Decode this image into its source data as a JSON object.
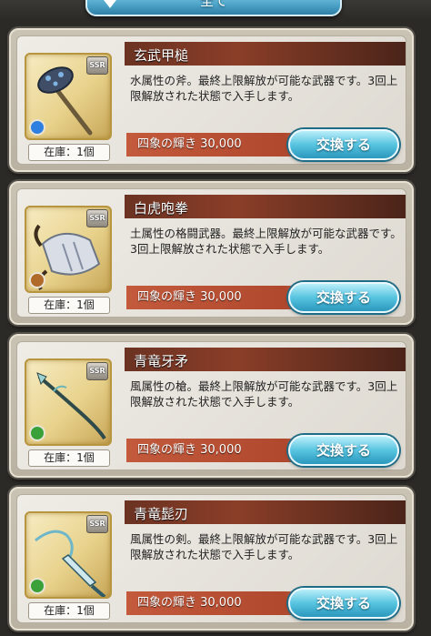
{
  "filter": {
    "label": "全て"
  },
  "items": [
    {
      "name": "玄武甲槌",
      "rarity": "SSR",
      "element": "water",
      "element_color": "#2f7fe0",
      "icon": "hammer-icon",
      "description": "水属性の斧。最終上限解放が可能な武器です。3回上限解放された状態で入手します。",
      "cost": "四象の輝き 30,000",
      "stock": "在庫：1個",
      "button": "交換する"
    },
    {
      "name": "白虎咆拳",
      "rarity": "SSR",
      "element": "earth",
      "element_color": "#b06a2a",
      "icon": "gauntlet-icon",
      "description": "土属性の格闘武器。最終上限解放が可能な武器です。3回上限解放された状態で入手します。",
      "cost": "四象の輝き 30,000",
      "stock": "在庫：1個",
      "button": "交換する"
    },
    {
      "name": "青竜牙矛",
      "rarity": "SSR",
      "element": "wind",
      "element_color": "#3aa13a",
      "icon": "spear-icon",
      "description": "風属性の槍。最終上限解放が可能な武器です。3回上限解放された状態で入手します。",
      "cost": "四象の輝き 30,000",
      "stock": "在庫：1個",
      "button": "交換する"
    },
    {
      "name": "青竜髭刃",
      "rarity": "SSR",
      "element": "wind",
      "element_color": "#3aa13a",
      "icon": "sword-icon",
      "description": "風属性の剣。最終上限解放が可能な武器です。3回上限解放された状態で入手します。",
      "cost": "四象の輝き 30,000",
      "stock": "在庫：1個",
      "button": "交換する"
    }
  ]
}
